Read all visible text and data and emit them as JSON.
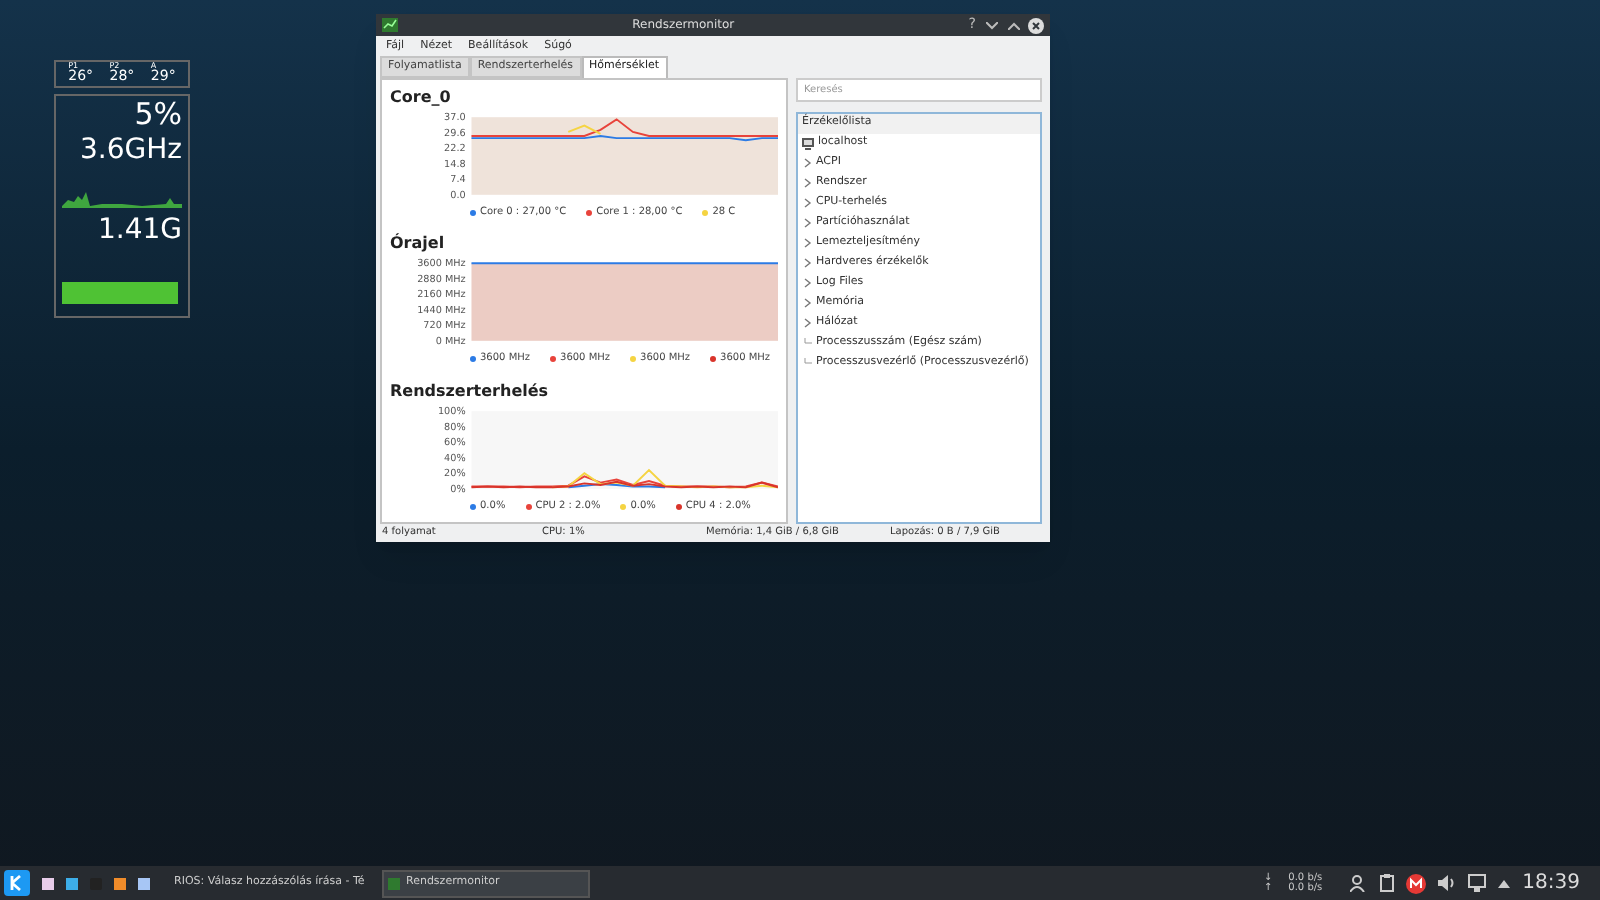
{
  "widget": {
    "temps": [
      {
        "label": "P1",
        "value": "26°"
      },
      {
        "label": "P2",
        "value": "28°"
      },
      {
        "label": "A",
        "value": "29°"
      }
    ],
    "cpu": "5%",
    "frequency": "3.6GHz",
    "memory": "1.41G"
  },
  "window": {
    "title": "Rendszermonitor",
    "help": "?",
    "menu": [
      "Fájl",
      "Nézet",
      "Beállítások",
      "Súgó"
    ],
    "tabs": [
      {
        "label": "Folyamatlista",
        "selected": false
      },
      {
        "label": "Rendszerterhelés",
        "selected": false
      },
      {
        "label": "Hőmérséklet",
        "selected": true
      }
    ],
    "charts": [
      {
        "title": "Core_0",
        "chart_data": {
          "type": "line",
          "categories": [
            null,
            null,
            null,
            null,
            null,
            null,
            null,
            null,
            null,
            null,
            null,
            null,
            null,
            null,
            null,
            null,
            null,
            null,
            null,
            null
          ],
          "ylim": [
            0,
            37
          ],
          "yticks": [
            {
              "value": 0,
              "label": "0.0"
            },
            {
              "value": 7.4,
              "label": "7.4"
            },
            {
              "value": 14.8,
              "label": "14.8"
            },
            {
              "value": 22.2,
              "label": "22.2"
            },
            {
              "value": 29.6,
              "label": "29.6"
            },
            {
              "value": 37,
              "label": "37.0"
            }
          ],
          "series": [
            {
              "name": "Core 0 : 27,00 °C",
              "color": "#2c7be5",
              "values": [
                27,
                27,
                27,
                27,
                27,
                27,
                27,
                27,
                28,
                27,
                27,
                27,
                27,
                27,
                27,
                27,
                27,
                26,
                27,
                27
              ]
            },
            {
              "name": "Core 1 : 28,00 °C",
              "color": "#e8433b",
              "values": [
                28,
                28,
                28,
                28,
                28,
                28,
                28,
                28,
                31,
                36,
                30,
                28,
                28,
                28,
                28,
                28,
                28,
                28,
                28,
                28
              ]
            },
            {
              "name": "28 C",
              "color": "#f5d442",
              "values": [
                null,
                null,
                null,
                null,
                null,
                null,
                30,
                33,
                29,
                null,
                null,
                null,
                null,
                null,
                null,
                null,
                null,
                null,
                null,
                null
              ]
            }
          ]
        }
      },
      {
        "title": "Órajel",
        "chart_data": {
          "type": "line",
          "categories": [
            null,
            null,
            null,
            null,
            null,
            null,
            null,
            null,
            null,
            null,
            null,
            null,
            null,
            null,
            null,
            null,
            null,
            null,
            null,
            null
          ],
          "ylim": [
            0,
            3600
          ],
          "yticks": [
            {
              "value": 0,
              "label": "0 MHz"
            },
            {
              "value": 720,
              "label": "720 MHz"
            },
            {
              "value": 1440,
              "label": "1440 MHz"
            },
            {
              "value": 2160,
              "label": "2160 MHz"
            },
            {
              "value": 2880,
              "label": "2880 MHz"
            },
            {
              "value": 3600,
              "label": "3600 MHz"
            }
          ],
          "series": [
            {
              "name": "3600 MHz",
              "color": "#2c7be5",
              "values": [
                3600,
                3600,
                3600,
                3600,
                3600,
                3600,
                3600,
                3600,
                3600,
                3600,
                3600,
                3600,
                3600,
                3600,
                3600,
                3600,
                3600,
                3600,
                3600,
                3600
              ]
            },
            {
              "name": "3600 MHz",
              "color": "#e8433b",
              "values": [
                null,
                null,
                null,
                null,
                null,
                null,
                null,
                null,
                null,
                null,
                null,
                null,
                null,
                null,
                null,
                null,
                null,
                null,
                null,
                null
              ]
            },
            {
              "name": "3600 MHz",
              "color": "#f5d442",
              "values": [
                null,
                null,
                null,
                null,
                null,
                null,
                null,
                null,
                null,
                null,
                null,
                null,
                null,
                null,
                null,
                null,
                null,
                null,
                null,
                null
              ]
            },
            {
              "name": "3600 MHz",
              "color": "#d9342b",
              "values": [
                null,
                null,
                null,
                null,
                null,
                null,
                null,
                null,
                null,
                null,
                null,
                null,
                null,
                null,
                null,
                null,
                null,
                null,
                null,
                null
              ]
            }
          ]
        }
      },
      {
        "title": "Rendszerterhelés",
        "chart_data": {
          "type": "line",
          "categories": [
            null,
            null,
            null,
            null,
            null,
            null,
            null,
            null,
            null,
            null,
            null,
            null,
            null,
            null,
            null,
            null,
            null,
            null,
            null,
            null
          ],
          "ylim": [
            0,
            100
          ],
          "yticks": [
            {
              "value": 0,
              "label": "0%"
            },
            {
              "value": 20,
              "label": "20%"
            },
            {
              "value": 40,
              "label": "40%"
            },
            {
              "value": 60,
              "label": "60%"
            },
            {
              "value": 80,
              "label": "80%"
            },
            {
              "value": 100,
              "label": "100%"
            }
          ],
          "series": [
            {
              "name": "0.0%",
              "color": "#2c7be5",
              "values": [
                null,
                null,
                null,
                null,
                null,
                null,
                2,
                4,
                6,
                5,
                3,
                3,
                2,
                null,
                null,
                null,
                null,
                null,
                null,
                null
              ]
            },
            {
              "name": "CPU 2 : 2.0%",
              "color": "#e8433b",
              "values": [
                3,
                3,
                3,
                2,
                3,
                3,
                4,
                16,
                8,
                12,
                5,
                10,
                4,
                3,
                3,
                3,
                2,
                3,
                8,
                3
              ]
            },
            {
              "name": "0.0%",
              "color": "#f5d442",
              "values": [
                null,
                null,
                null,
                null,
                null,
                2,
                3,
                20,
                6,
                8,
                4,
                24,
                4,
                3,
                2,
                3,
                2,
                2,
                4,
                2
              ]
            },
            {
              "name": "CPU 4 : 2.0%",
              "color": "#d9342b",
              "values": [
                2,
                3,
                2,
                3,
                2,
                2,
                3,
                7,
                5,
                9,
                4,
                6,
                3,
                2,
                3,
                2,
                3,
                2,
                8,
                2
              ]
            }
          ]
        }
      }
    ],
    "search": {
      "placeholder": "Keresés"
    },
    "sensor_list": {
      "header": "Érzékelőlista",
      "root": "localhost",
      "children": [
        {
          "label": "ACPI",
          "kind": "group"
        },
        {
          "label": "Rendszer",
          "kind": "group"
        },
        {
          "label": "CPU-terhelés",
          "kind": "group"
        },
        {
          "label": "Partícióhasználat",
          "kind": "group"
        },
        {
          "label": "Lemezteljesítmény",
          "kind": "group"
        },
        {
          "label": "Hardveres érzékelők",
          "kind": "group"
        },
        {
          "label": "Log Files",
          "kind": "group"
        },
        {
          "label": "Memória",
          "kind": "group"
        },
        {
          "label": "Hálózat",
          "kind": "group"
        },
        {
          "label": "Processzusszám (Egész szám)",
          "kind": "leaf"
        },
        {
          "label": "Processzusvezérlő (Processzusvezérlő)",
          "kind": "leaf"
        }
      ]
    },
    "status_bar": [
      "4 folyamat",
      "CPU: 1%",
      "Memória: 1,4 GiB / 6,8 GiB",
      "Lapozás: 0 B / 7,9 GiB"
    ]
  },
  "taskbar": {
    "tasks": [
      {
        "label": "RIOS: Válasz hozzászólás írása - Té",
        "selected": false
      },
      {
        "label": "Rendszermonitor",
        "selected": true
      }
    ],
    "network": [
      {
        "arrow": "↓",
        "rate": "0.0 b/s"
      },
      {
        "arrow": "↑",
        "rate": "0.0 b/s"
      }
    ],
    "clock": "18:39"
  }
}
